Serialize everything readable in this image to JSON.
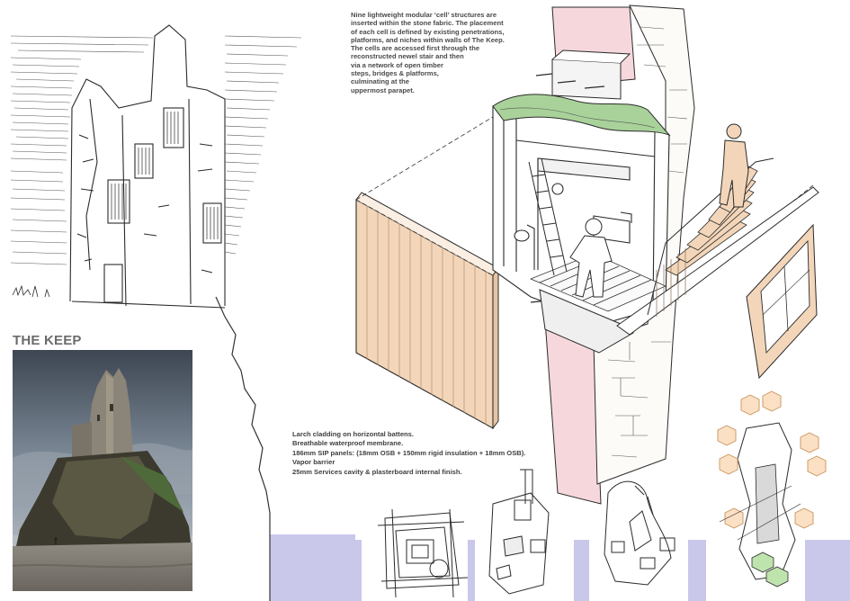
{
  "board": {
    "title": "THE KEEP",
    "intro_lines": [
      "Nine lightweight modular ‘cell’ structures are",
      "inserted within the stone fabric. The placement",
      "of each cell is defined by existing penetrations,",
      "platforms, and niches within walls of The Keep.",
      "The cells are accessed first through the",
      "reconstructed newel stair and then",
      "via a network of open timber",
      "steps, bridges & platforms,",
      "culminating at the",
      "uppermost parapet."
    ],
    "spec_lines": [
      "Larch cladding on horizontal battens.",
      "Breathable waterproof membrane.",
      "186mm SIP panels: (18mm OSB + 150mm rigid insulation + 18mm OSB).",
      "Vapor barrier",
      "25mm Services cavity & plasterboard internal finish."
    ]
  },
  "colors": {
    "ink": "#2b2b2b",
    "larch": "#f3d6ba",
    "pink_wall": "#f6d8dc",
    "lavender": "#c9c7ea",
    "green_roof": "#a9d29a",
    "sky": "#8797a8",
    "stone_photo": "#8b8478"
  },
  "icons": {
    "person": "person-silhouette-icon"
  }
}
